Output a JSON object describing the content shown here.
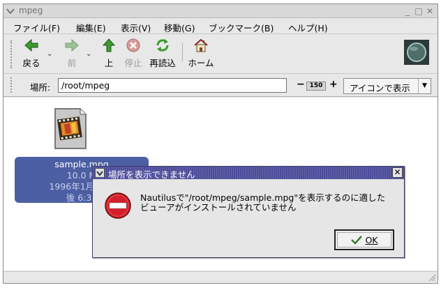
{
  "window": {
    "title": "mpeg",
    "minimize": "_",
    "maximize": "□",
    "close": "✕"
  },
  "menubar": {
    "items": [
      {
        "label": "ファイル(F)"
      },
      {
        "label": "編集(E)"
      },
      {
        "label": "表示(V)"
      },
      {
        "label": "移動(G)"
      },
      {
        "label": "ブックマーク(B)"
      },
      {
        "label": "ヘルプ(H)"
      }
    ]
  },
  "toolbar": {
    "back": "戻る",
    "forward": "前",
    "up": "上",
    "stop": "停止",
    "reload": "再読込",
    "home": "ホーム"
  },
  "location": {
    "label": "場所:",
    "value": "/root/mpeg",
    "zoom": "150",
    "zoom_minus": "−",
    "zoom_plus": "+",
    "view_mode": "アイコンで表示"
  },
  "file": {
    "name": "sample.mpg",
    "size": "10.0 M",
    "date": "1996年1月25日",
    "time": "後 6:30"
  },
  "dialog": {
    "title": "場所を表示できません",
    "message_line1": "Nautilusで\"/root/mpeg/sample.mpg\"を表示するのに適した",
    "message_line2": "ビューアがインストールされていません",
    "ok": "OK",
    "close": "✕"
  },
  "colors": {
    "selection": "#4d5fa3",
    "dialog_title": "#4b4b9a",
    "error": "#d2202a"
  }
}
